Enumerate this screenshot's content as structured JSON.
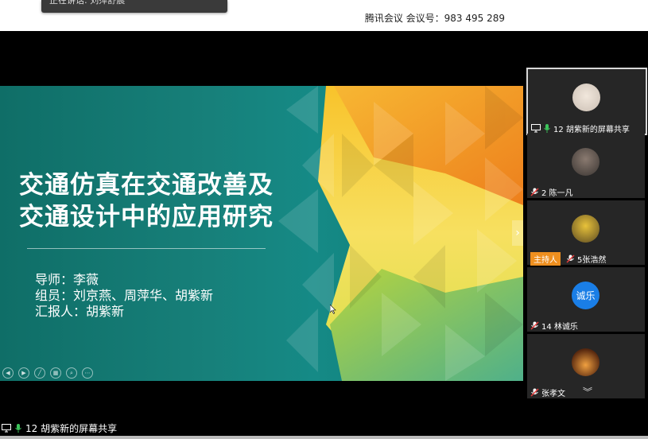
{
  "top": {
    "toast_text": "正在讲话: 刘萍舒晨",
    "meeting_label": "腾讯会议  会议号：983 495 289"
  },
  "slide": {
    "title_line1": "交通仿真在交通改善及",
    "title_line2": "交通设计中的应用研究",
    "advisor": "导师：李薇",
    "members": "组员：刘京燕、周萍华、胡紫新",
    "presenter": "汇报人：胡紫新",
    "colors": {
      "teal": "#17807a",
      "yellow": "#f6c629",
      "orange": "#f09a1d",
      "green": "#a9cf3c"
    }
  },
  "participants": [
    {
      "label": "12 胡紫新的屏幕共享",
      "host": false,
      "icon": "screen-share-icon",
      "active": true
    },
    {
      "label": "2 陈一凡",
      "host": false,
      "icon": "mic-muted-icon",
      "active": false
    },
    {
      "label": "5张浩然",
      "host": true,
      "host_label": "主持人",
      "icon": "mic-muted-icon",
      "active": false
    },
    {
      "label": "14 林诚乐",
      "host": false,
      "icon": "mic-muted-icon",
      "avatar_text": "诚乐",
      "active": false
    },
    {
      "label": "张孝文",
      "host": false,
      "icon": "mic-muted-icon",
      "active": false
    }
  ],
  "bottom": {
    "share_label": "12 胡紫新的屏幕共享"
  }
}
